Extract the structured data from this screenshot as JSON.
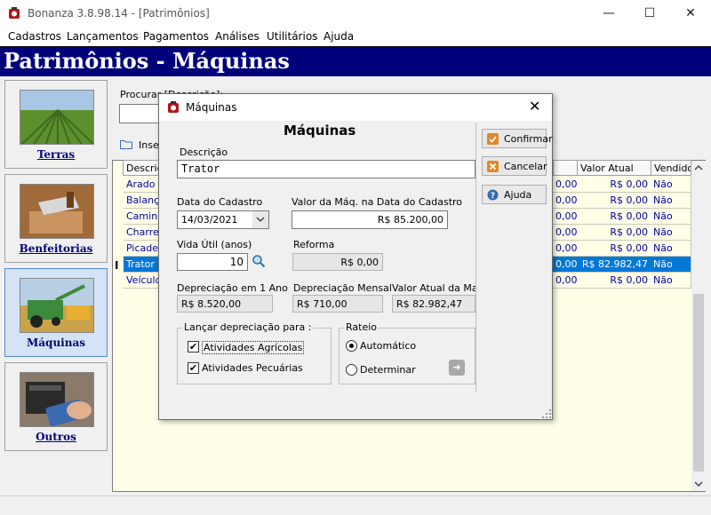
{
  "window": {
    "title": "Bonanza 3.8.98.14 - [Patrimônios]",
    "minimize": "—",
    "maximize": "☐",
    "close": "✕"
  },
  "menu": [
    "Cadastros",
    "Lançamentos",
    "Pagamentos",
    "Análises",
    "Utilitários",
    "Ajuda"
  ],
  "banner": "Patrimônios - Máquinas",
  "sidebar": [
    {
      "label": "Terras"
    },
    {
      "label": "Benfeitorias"
    },
    {
      "label": "Máquinas"
    },
    {
      "label": "Outros"
    }
  ],
  "search": {
    "label": "Procurar [Descrição]:"
  },
  "toolbar": {
    "insert_label": "Inse"
  },
  "grid": {
    "headers": {
      "descricao": "Descrição",
      "valor_atual": "Valor Atual",
      "vendido": "Vendido"
    },
    "rows": [
      {
        "desc": "Arado",
        "mid": "0,00",
        "valor": "R$ 0,00",
        "vendido": "Não"
      },
      {
        "desc": "Balança",
        "mid": "0,00",
        "valor": "R$ 0,00",
        "vendido": "Não"
      },
      {
        "desc": "Caminhão",
        "mid": "0,00",
        "valor": "R$ 0,00",
        "vendido": "Não"
      },
      {
        "desc": "Charrete",
        "mid": "0,00",
        "valor": "R$ 0,00",
        "vendido": "Não"
      },
      {
        "desc": "Picadeira",
        "mid": "0,00",
        "valor": "R$ 0,00",
        "vendido": "Não"
      },
      {
        "desc": "Trator",
        "mid": "0,00",
        "valor": "R$ 82.982,47",
        "vendido": "Não"
      },
      {
        "desc": "Veículo",
        "mid": "0,00",
        "valor": "R$ 0,00",
        "vendido": "Não"
      }
    ],
    "row_indicator": "I"
  },
  "dialog": {
    "title": "Máquinas",
    "close": "✕",
    "heading": "Máquinas",
    "descricao_label": "Descrição",
    "descricao_value": "Trator",
    "data_label": "Data do Cadastro",
    "data_value": "14/03/2021",
    "valor_label": "Valor da Máq. na Data do Cadastro",
    "valor_value": "R$ 85.200,00",
    "vida_label": "Vida Útil (anos)",
    "vida_value": "10",
    "reforma_label": "Reforma",
    "reforma_value": "R$ 0,00",
    "dep_ano_label": "Depreciação em 1 Ano",
    "dep_ano_value": "R$ 8.520,00",
    "dep_mes_label": "Depreciação Mensal",
    "dep_mes_value": "R$ 710,00",
    "valor_atual_label": "Valor Atual da Maq.",
    "valor_atual_value": "R$ 82.982,47",
    "lancar_label": "Lançar depreciação para :",
    "agricolas_label": "Atividades Agrícolas",
    "pecuarias_label": "Atividades Pecuárias",
    "rateio_label": "Rateio",
    "automatico_label": "Automático",
    "determinar_label": "Determinar",
    "confirmar": "Confirmar",
    "cancelar": "Cancelar",
    "ajuda": "Ajuda",
    "checkmark": "✔",
    "arrow": "➜"
  }
}
